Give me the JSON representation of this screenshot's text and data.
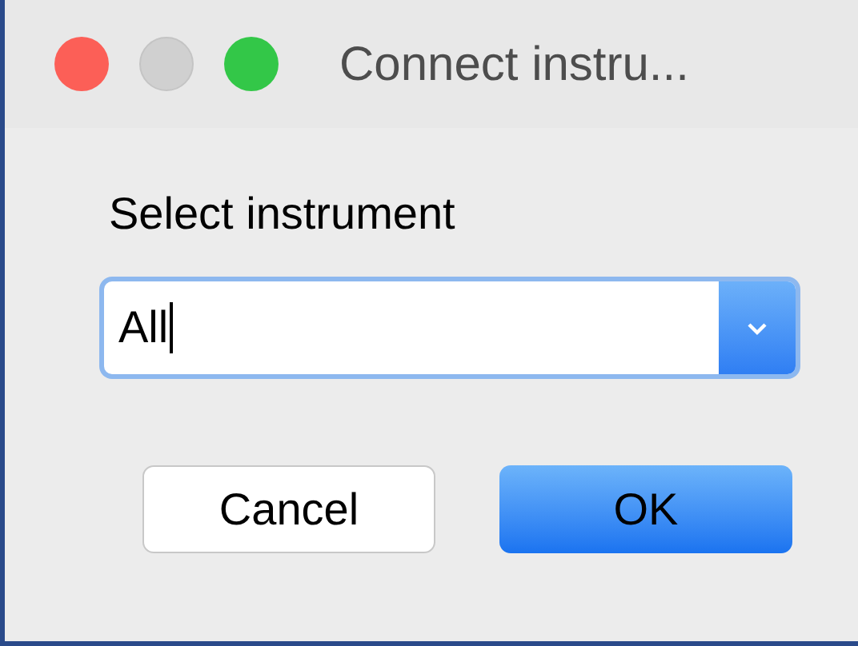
{
  "window": {
    "title": "Connect instru...",
    "controls": [
      {
        "kind": "close",
        "disabled": false
      },
      {
        "kind": "minimize",
        "disabled": true
      },
      {
        "kind": "zoom",
        "disabled": false
      }
    ]
  },
  "label": "Select instrument",
  "combo": {
    "value": "All",
    "focused": true
  },
  "buttons": [
    {
      "label": "Cancel",
      "kind": "default"
    },
    {
      "label": "OK",
      "kind": "primary"
    }
  ]
}
